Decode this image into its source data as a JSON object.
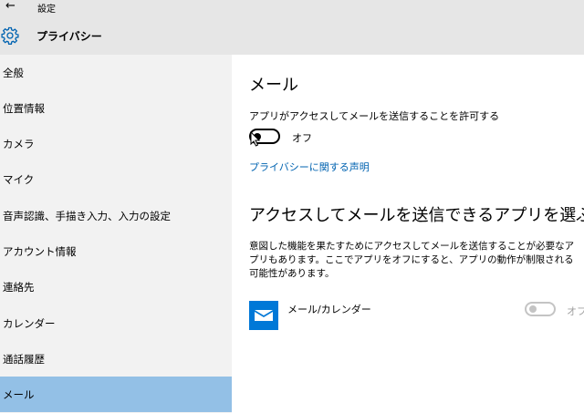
{
  "window": {
    "back_icon": "←",
    "title": "設定"
  },
  "header": {
    "title": "プライバシー",
    "icon": "gear-icon"
  },
  "sidebar": {
    "items": [
      {
        "label": "全般"
      },
      {
        "label": "位置情報"
      },
      {
        "label": "カメラ"
      },
      {
        "label": "マイク"
      },
      {
        "label": "音声認識、手描き入力、入力の設定"
      },
      {
        "label": "アカウント情報"
      },
      {
        "label": "連絡先"
      },
      {
        "label": "カレンダー"
      },
      {
        "label": "通話履歴"
      },
      {
        "label": "メール",
        "active": true
      }
    ]
  },
  "main": {
    "heading": "メール",
    "allow_label": "アプリがアクセスしてメールを送信することを許可する",
    "toggle_state": "オフ",
    "privacy_link": "プライバシーに関する声明",
    "choose_heading": "アクセスしてメールを送信できるアプリを選ぶ",
    "description": "意図した機能を果たすためにアクセスしてメールを送信することが必要なアプリもあります。ここでアプリをオフにすると、アプリの動作が制限される可能性があります。",
    "apps": [
      {
        "name": "メール/カレンダー",
        "state": "オフ",
        "icon": "mail-icon"
      }
    ]
  },
  "colors": {
    "accent": "#0078d7",
    "link": "#0063b1",
    "selected": "#93c0e6",
    "chrome": "#e6e6e6",
    "sidebar": "#f2f2f2"
  }
}
